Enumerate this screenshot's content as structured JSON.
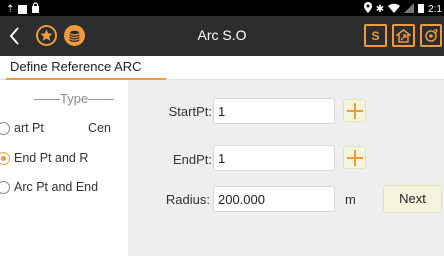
{
  "status_bar": {
    "time": "2:1"
  },
  "app_bar": {
    "title": "Arc S.O",
    "s_label": "S"
  },
  "tab": {
    "label": "Define Reference ARC"
  },
  "type_panel": {
    "label": "——Type——",
    "options": [
      {
        "label": "art Pt",
        "extra": "Cen",
        "selected": false
      },
      {
        "label": "End Pt and R",
        "extra": "",
        "selected": true
      },
      {
        "label": "Arc Pt and End",
        "extra": "",
        "selected": false
      }
    ]
  },
  "form": {
    "start_label": "StartPt:",
    "start_value": "1",
    "end_label": "EndPt:",
    "end_value": "1",
    "radius_label": "Radius:",
    "radius_value": "200.000",
    "radius_unit": "m",
    "next_label": "Next"
  },
  "colors": {
    "accent": "#f09a3b",
    "appbar": "#2b2d2f",
    "panel": "#eceef0"
  }
}
